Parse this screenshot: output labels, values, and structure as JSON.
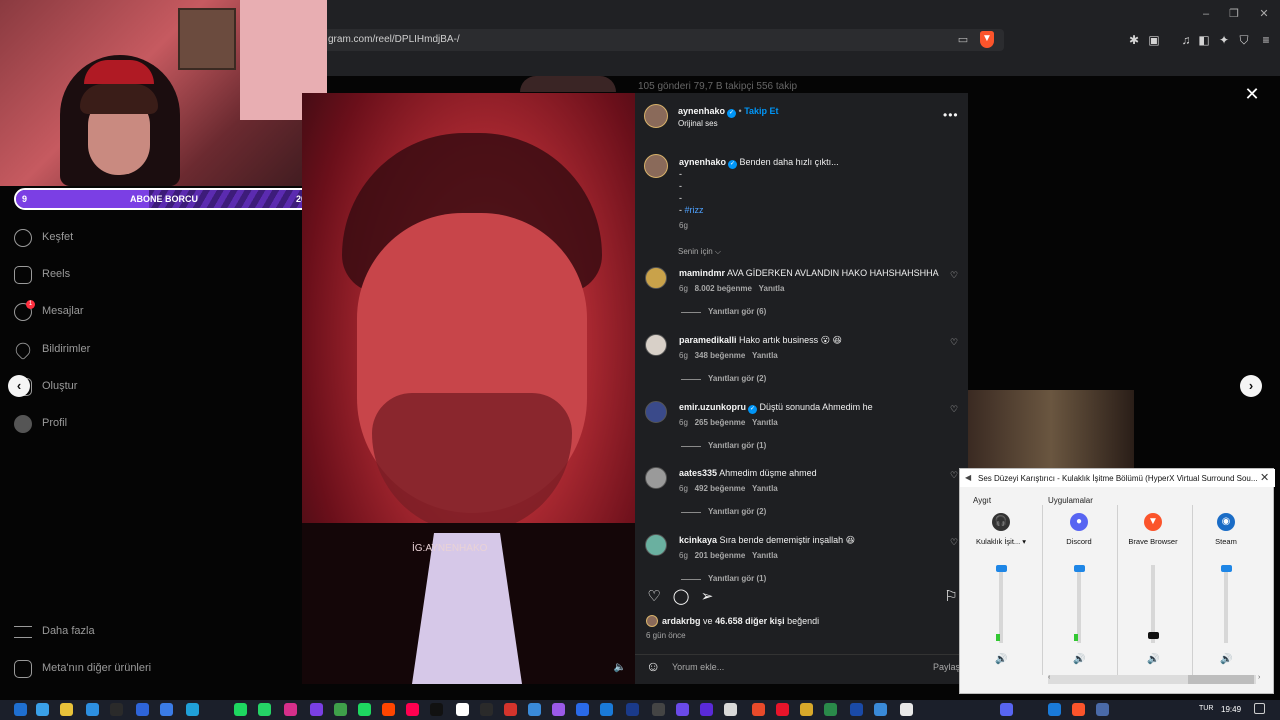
{
  "browser": {
    "url": "gram.com/reel/DPLIHmdjBA-/",
    "window_controls": [
      "–",
      "❐",
      "✕"
    ]
  },
  "profile_strip": {
    "text": "105 gönderi   79,7 B takipçi   556 takip"
  },
  "overlay_widget": {
    "label": "ABONE BORCU",
    "left_value": "9",
    "right_value": "20",
    "progress": 0.45
  },
  "sidebar": {
    "items": [
      {
        "label": "Keşfet",
        "icon": "compass-icon"
      },
      {
        "label": "Reels",
        "icon": "reels-icon"
      },
      {
        "label": "Mesajlar",
        "icon": "messenger-icon",
        "badge": "1"
      },
      {
        "label": "Bildirimler",
        "icon": "heart-icon"
      },
      {
        "label": "Oluştur",
        "icon": "plus-icon"
      },
      {
        "label": "Profil",
        "icon": "avatar-icon"
      }
    ],
    "bottom_items": [
      {
        "label": "Daha fazla",
        "icon": "menu-icon"
      },
      {
        "label": "Meta'nın diğer ürünleri",
        "icon": "grid-icon"
      }
    ]
  },
  "video": {
    "watermark": "İG:AYNENHAKO"
  },
  "post": {
    "author": "aynenhako",
    "follow_label": "Takip Et",
    "audio": "Orijinal ses",
    "caption": "Benden daha hızlı çıktı...",
    "caption_lines": [
      "-",
      "-",
      "-"
    ],
    "hashtag_prefix": "-",
    "hashtag": "#rizz",
    "caption_time": "6g",
    "filter": "Senin için",
    "likes_text_user": "ardakrbg",
    "likes_text_mid": "ve",
    "likes_text_count": "46.658 diğer kişi",
    "likes_text_end": "beğendi",
    "date": "6 gün önce",
    "comment_placeholder": "Yorum ekle...",
    "share_label": "Paylaş"
  },
  "comments": [
    {
      "user": "mamindmr",
      "verified": false,
      "text": "AVA GİDERKEN AVLANDIN HAKO HAHSHAHSHHA",
      "time": "6g",
      "likes": "8.002 beğenme",
      "reply": "Yanıtla",
      "replies": "Yanıtları gör (6)"
    },
    {
      "user": "paramedikalli",
      "verified": false,
      "text": "Hako artık business 😮 😆",
      "time": "6g",
      "likes": "348 beğenme",
      "reply": "Yanıtla",
      "replies": "Yanıtları gör (2)"
    },
    {
      "user": "emir.uzunkopru",
      "verified": true,
      "text": "Düştü sonunda Ahmedim he",
      "time": "6g",
      "likes": "265 beğenme",
      "reply": "Yanıtla",
      "replies": "Yanıtları gör (1)"
    },
    {
      "user": "aates335",
      "verified": false,
      "text": "Ahmedim düşme ahmed",
      "time": "6g",
      "likes": "492 beğenme",
      "reply": "Yanıtla",
      "replies": "Yanıtları gör (2)"
    },
    {
      "user": "kcinkaya",
      "verified": false,
      "text": "Sıra bende dememiştir inşallah 😆",
      "time": "6g",
      "likes": "201 beğenme",
      "reply": "Yanıtla",
      "replies": "Yanıtları gör (1)"
    }
  ],
  "mixer": {
    "title": "Ses Düzeyi Karıştırıcı - Kulaklık İşitme Bölümü (HyperX Virtual Surround Sou...",
    "device_section": "Aygıt",
    "apps_section": "Uygulamalar",
    "columns": [
      {
        "label": "Kulaklık İşit... ▾",
        "icon": "headset-icon",
        "level": 1.0,
        "meter": 0.1
      },
      {
        "label": "Discord",
        "icon": "discord-icon",
        "level": 1.0,
        "meter": 0.1
      },
      {
        "label": "Brave Browser",
        "icon": "brave-icon",
        "level": 0.05,
        "meter": 0.0
      },
      {
        "label": "Steam",
        "icon": "steam-icon",
        "level": 1.0,
        "meter": 0.0
      }
    ]
  },
  "taskbar": {
    "lang": "TUR",
    "time": "19:49"
  },
  "colors": {
    "accent": "#0095f6",
    "panel_bg": "#1e1f22",
    "mixer_slider": "#1e86e6"
  }
}
